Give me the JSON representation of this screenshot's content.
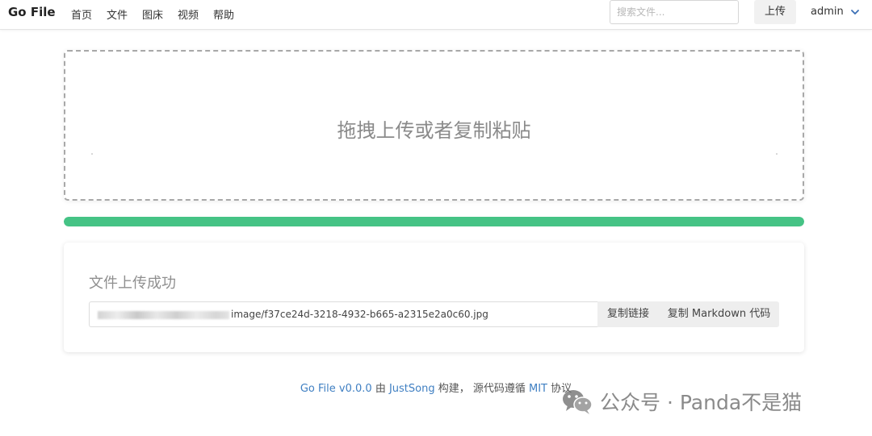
{
  "navbar": {
    "brand": "Go File",
    "links": [
      "首页",
      "文件",
      "图床",
      "视频",
      "帮助"
    ],
    "search_placeholder": "搜索文件...",
    "upload_label": "上传",
    "user_label": "admin"
  },
  "dropzone": {
    "text": "拖拽上传或者复制粘贴"
  },
  "progress": {
    "percent": 100,
    "color": "#45c385"
  },
  "result": {
    "title": "文件上传成功",
    "url_suffix": "image/f37ce24d-3218-4932-b665-a2315e2a0c60.jpg",
    "copy_link_label": "复制链接",
    "copy_markdown_label": "复制 Markdown 代码"
  },
  "footer": {
    "app_link": "Go File v0.0.0",
    "by": " 由 ",
    "author_link": "JustSong",
    "built": " 构建， 源代码遵循 ",
    "license_link": "MIT",
    "license_suffix": " 协议"
  },
  "watermark": {
    "text": "公众号 · Panda不是猫",
    "icon": "wechat-icon"
  },
  "colors": {
    "accent": "#45c385",
    "link": "#3f7fc2"
  }
}
